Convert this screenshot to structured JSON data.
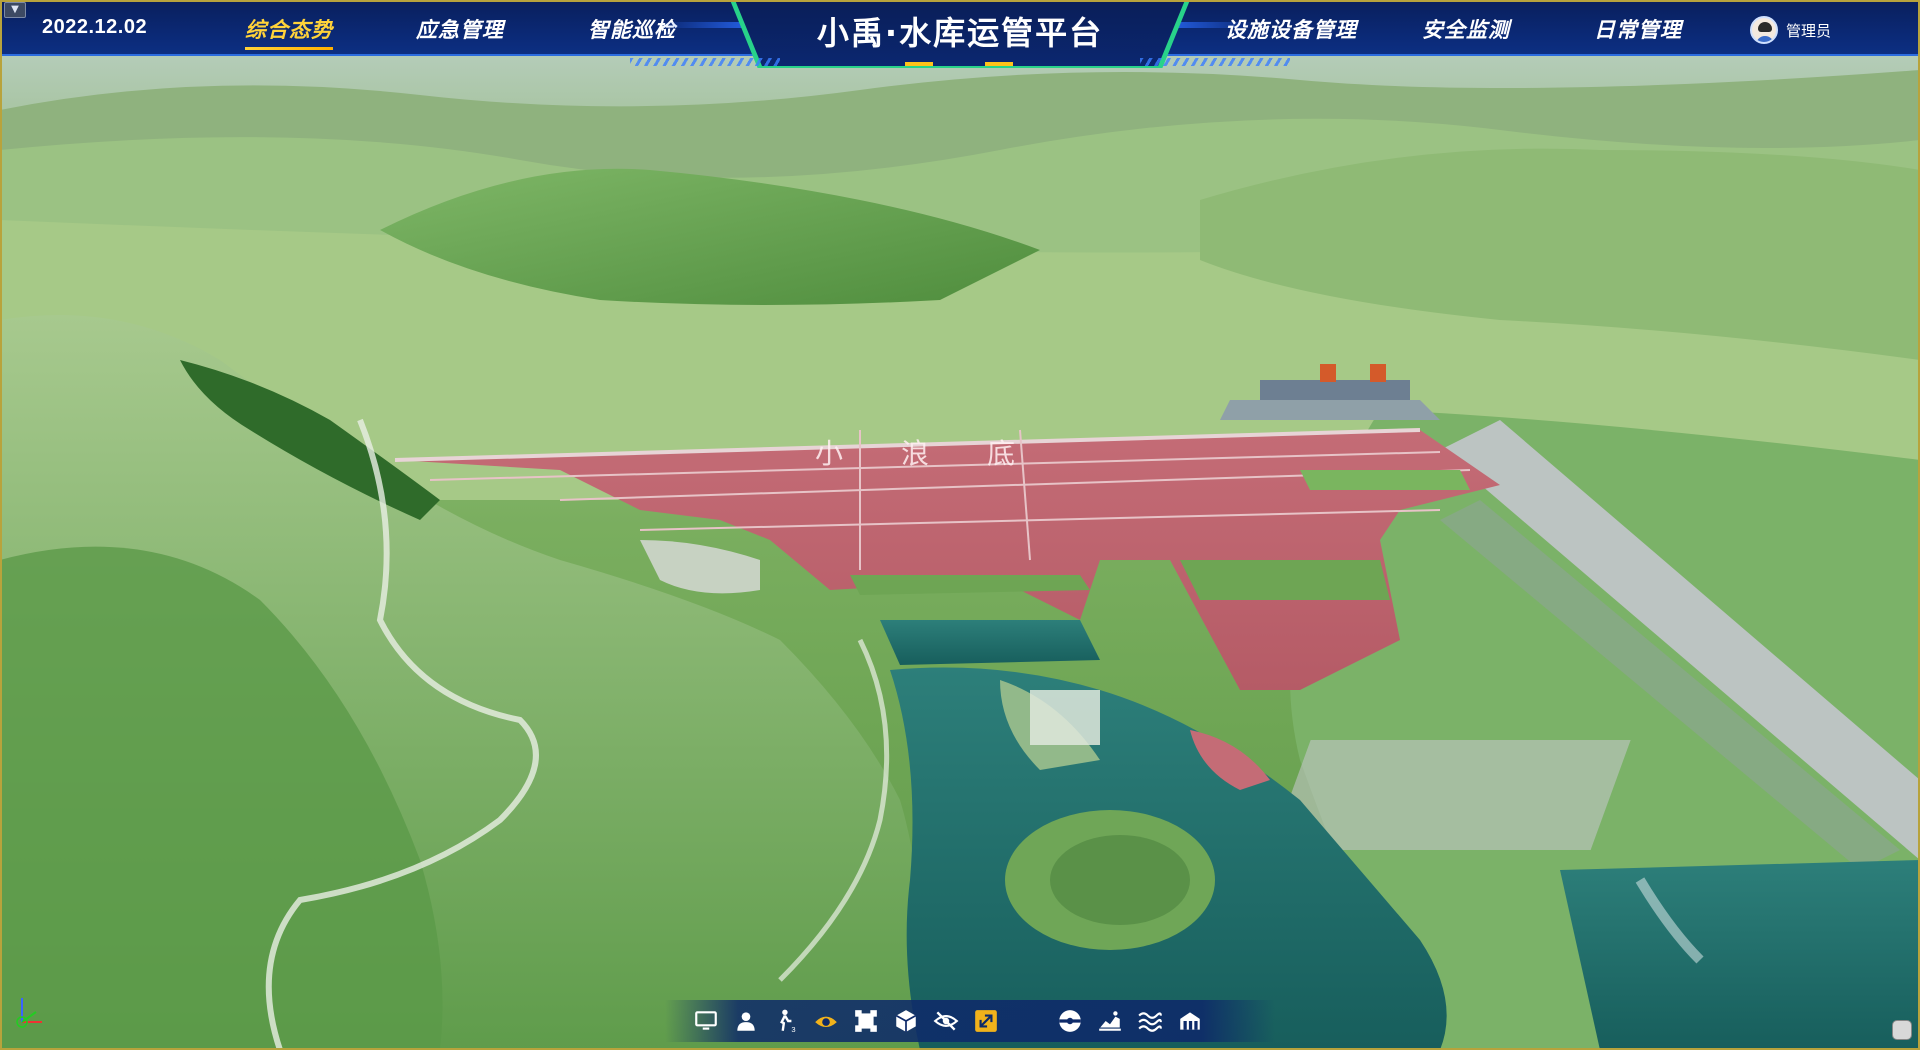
{
  "header": {
    "date": "2022.12.02",
    "title": "小禹·水库运管平台",
    "nav_left": [
      {
        "label": "综合态势",
        "active": true
      },
      {
        "label": "应急管理",
        "active": false
      },
      {
        "label": "智能巡检",
        "active": false
      }
    ],
    "nav_right": [
      {
        "label": "设施设备管理",
        "active": false
      },
      {
        "label": "安全监测",
        "active": false
      },
      {
        "label": "日常管理",
        "active": false
      }
    ],
    "user": {
      "name": "管理员",
      "icon": "user-avatar"
    }
  },
  "scene": {
    "dam_text": "小浪底"
  },
  "toolbar": {
    "tools": [
      {
        "icon": "monitor-icon"
      },
      {
        "icon": "person-icon"
      },
      {
        "icon": "person-3-icon"
      },
      {
        "icon": "eye-icon",
        "active": true
      },
      {
        "icon": "frame-select-icon"
      },
      {
        "icon": "cube-icon"
      },
      {
        "icon": "eye-hidden-icon"
      },
      {
        "icon": "fullscreen-icon",
        "active": true
      },
      {
        "icon": "globe-icon"
      },
      {
        "icon": "chart-area-icon"
      },
      {
        "icon": "water-level-icon"
      },
      {
        "icon": "building-icon"
      }
    ]
  },
  "colors": {
    "header_bg": "#0b2a78",
    "active_nav": "#ffd23a",
    "title_border": "#28d28a",
    "dam_face": "#c9707a",
    "water": "#1f6f6a"
  }
}
